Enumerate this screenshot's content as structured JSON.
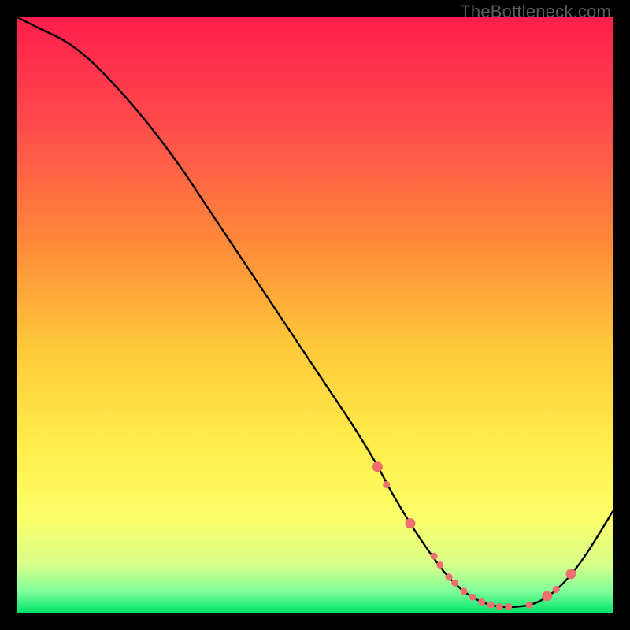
{
  "watermark": "TheBottleneck.com",
  "chart_data": {
    "type": "line",
    "title": "",
    "xlabel": "",
    "ylabel": "",
    "xlim": [
      0,
      100
    ],
    "ylim": [
      0,
      100
    ],
    "grid": false,
    "gradient_stops": [
      {
        "offset": 0.0,
        "color": "#ff1e4c"
      },
      {
        "offset": 0.18,
        "color": "#ff4b4b"
      },
      {
        "offset": 0.38,
        "color": "#ff8a3a"
      },
      {
        "offset": 0.55,
        "color": "#ffc83a"
      },
      {
        "offset": 0.72,
        "color": "#ffee4a"
      },
      {
        "offset": 0.84,
        "color": "#fdff6a"
      },
      {
        "offset": 0.92,
        "color": "#d7ff8a"
      },
      {
        "offset": 0.965,
        "color": "#7dff9a"
      },
      {
        "offset": 1.0,
        "color": "#00e56a"
      }
    ],
    "series": [
      {
        "name": "curve",
        "stroke": "#000000",
        "stroke_width": 2.4,
        "x": [
          0,
          4,
          8,
          12,
          16,
          20,
          24,
          28,
          32,
          36,
          40,
          44,
          48,
          52,
          56,
          60,
          63,
          66,
          69,
          72,
          75,
          78,
          81,
          84,
          87,
          90,
          93,
          96,
          100
        ],
        "y": [
          100,
          98,
          96,
          93,
          89,
          84.5,
          79.5,
          74,
          68,
          62,
          56,
          50,
          44,
          38,
          32,
          25.5,
          20,
          15,
          10.5,
          6.5,
          3.6,
          1.8,
          1.0,
          1.0,
          1.6,
          3.4,
          6.4,
          10.5,
          17
        ]
      }
    ],
    "markers": {
      "color": "#ef6e6e",
      "radius_small": 4.5,
      "radius_large": 6.5,
      "points": [
        {
          "x": 60.5,
          "y": 24.5,
          "r": "large"
        },
        {
          "x": 62.0,
          "y": 21.5,
          "r": "small"
        },
        {
          "x": 66.0,
          "y": 15.0,
          "r": "large"
        },
        {
          "x": 70.0,
          "y": 9.5,
          "r": "small"
        },
        {
          "x": 71.0,
          "y": 8.0,
          "r": "small"
        },
        {
          "x": 72.5,
          "y": 6.0,
          "r": "small"
        },
        {
          "x": 73.5,
          "y": 5.0,
          "r": "small"
        },
        {
          "x": 75.0,
          "y": 3.6,
          "r": "small"
        },
        {
          "x": 76.5,
          "y": 2.6,
          "r": "small"
        },
        {
          "x": 78.0,
          "y": 1.8,
          "r": "small"
        },
        {
          "x": 79.5,
          "y": 1.3,
          "r": "small"
        },
        {
          "x": 81.0,
          "y": 1.0,
          "r": "small"
        },
        {
          "x": 82.5,
          "y": 1.0,
          "r": "small"
        },
        {
          "x": 86.0,
          "y": 1.3,
          "r": "small"
        },
        {
          "x": 89.0,
          "y": 2.8,
          "r": "large"
        },
        {
          "x": 90.5,
          "y": 3.9,
          "r": "small"
        },
        {
          "x": 93.0,
          "y": 6.5,
          "r": "large"
        }
      ]
    }
  }
}
